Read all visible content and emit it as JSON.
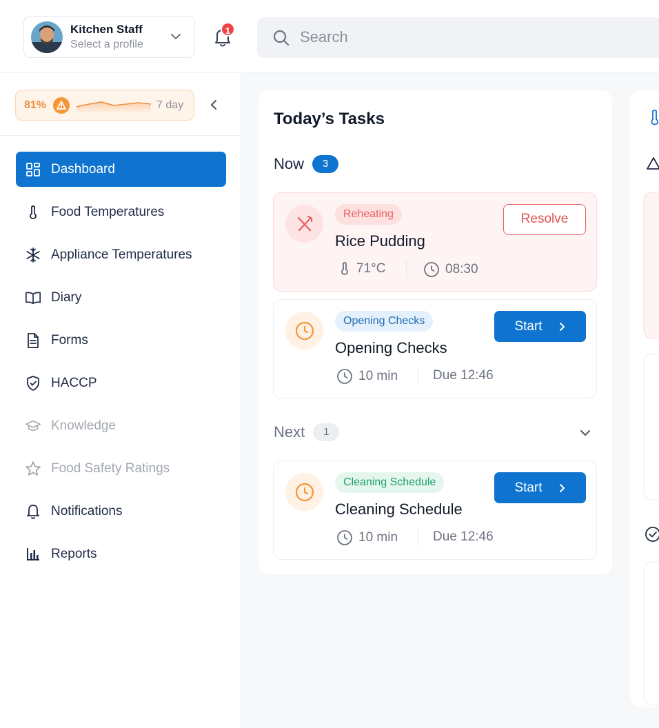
{
  "profile": {
    "name": "Kitchen Staff",
    "subtitle": "Select a profile"
  },
  "notifications": {
    "count": "1"
  },
  "search": {
    "placeholder": "Search"
  },
  "score": {
    "percent": "81%",
    "range": "7 day",
    "accent": "#f08c3a"
  },
  "sidebar": {
    "items": [
      {
        "label": "Dashboard",
        "icon": "grid-icon",
        "active": true
      },
      {
        "label": "Food Temperatures",
        "icon": "thermometer-icon"
      },
      {
        "label": "Appliance Temperatures",
        "icon": "snowflake-icon"
      },
      {
        "label": "Diary",
        "icon": "book-icon"
      },
      {
        "label": "Forms",
        "icon": "document-icon"
      },
      {
        "label": "HACCP",
        "icon": "shield-check-icon"
      },
      {
        "label": "Knowledge",
        "icon": "graduation-cap-icon",
        "disabled": true
      },
      {
        "label": "Food Safety Ratings",
        "icon": "star-icon",
        "disabled": true
      },
      {
        "label": "Notifications",
        "icon": "bell-icon"
      },
      {
        "label": "Reports",
        "icon": "bar-chart-icon"
      }
    ]
  },
  "tasks": {
    "title": "Today’s Tasks",
    "now": {
      "label": "Now",
      "count": "3",
      "items": [
        {
          "tag": "Reheating",
          "name": "Rice Pudding",
          "temp": "71°C",
          "time": "08:30",
          "action": "Resolve"
        },
        {
          "tag": "Opening Checks",
          "name": "Opening Checks",
          "duration": "10 min",
          "due": "Due 12:46",
          "action": "Start"
        }
      ]
    },
    "next": {
      "label": "Next",
      "count": "1",
      "items": [
        {
          "tag": "Cleaning Schedule",
          "name": "Cleaning Schedule",
          "duration": "10 min",
          "due": "Due 12:46",
          "action": "Start"
        }
      ]
    }
  },
  "colors": {
    "primary": "#0f74cf",
    "danger": "#e85d5d",
    "warning": "#f59637",
    "success": "#20a26b"
  }
}
